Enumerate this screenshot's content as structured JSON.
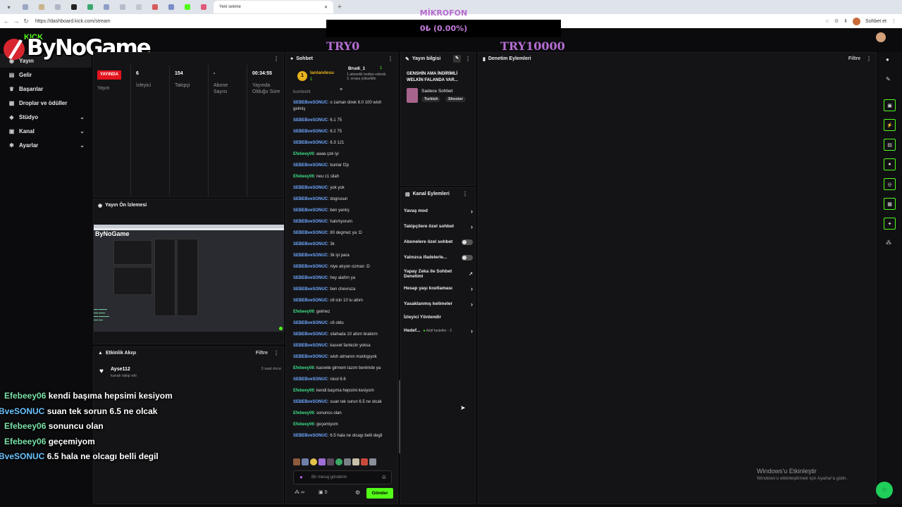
{
  "browser": {
    "active_tab": "Yeni sekme",
    "url": "https://dashboard.kick.com/stream",
    "profile_button": "Sohbet et"
  },
  "overlay": {
    "mic_label": "MİKROFON",
    "gauge_text": "0₺ (0.00%)",
    "try_min": "TRY0",
    "try_max": "TRY10000",
    "logo_text": "ByNoGame",
    "logo_kick": "KICK"
  },
  "sidebar": {
    "items": [
      {
        "label": "Yayın",
        "icon": "stream-icon"
      },
      {
        "label": "Gelir",
        "icon": "revenue-icon"
      },
      {
        "label": "Başarılar",
        "icon": "trophy-icon"
      },
      {
        "label": "Droplar ve ödüller",
        "icon": "gift-icon"
      },
      {
        "label": "Stüdyo",
        "icon": "studio-icon"
      },
      {
        "label": "Kanal",
        "icon": "channel-icon"
      },
      {
        "label": "Ayarlar",
        "icon": "settings-icon"
      }
    ]
  },
  "stats": {
    "live_badge": "YAYINDA",
    "live_label": "Yayın",
    "viewers_value": "6",
    "viewers_label": "İzleyici",
    "followers_value": "154",
    "followers_label": "Takipçi",
    "subs_value": "-",
    "subs_label": "Abone Sayısı",
    "duration_value": "00:34:55",
    "duration_label": "Yayında Olduğu Süre"
  },
  "preview": {
    "title": "Yayın Ön İzlemesi"
  },
  "activity": {
    "title": "Etkinlik Akışı",
    "filter": "Filtre",
    "event_user": "Ayse112",
    "event_text": "kanalı takip etti",
    "event_time": "3 saat önce"
  },
  "chat": {
    "title": "Sohbet",
    "pinned_user": "lanlandesu",
    "pinned_count": "1",
    "pinned_level": "1",
    "gift_user": "Brudi_1",
    "gift_text": "1 abonelik hediye ederek 3. sıraya yükseldin",
    "partial_top": "bomboktt",
    "messages": [
      {
        "user": "SEBEBveSONUC",
        "text": "o zaman direk 6.0 100 wish gelmiş",
        "c": 1
      },
      {
        "user": "SEBEBveSONUC",
        "text": "6.1 75",
        "c": 1
      },
      {
        "user": "SEBEBveSONUC",
        "text": "6.2 75",
        "c": 1
      },
      {
        "user": "SEBEBveSONUC",
        "text": "6.3 121",
        "c": 1
      },
      {
        "user": "Efebeey06",
        "text": "aaaa çok iyi",
        "c": 2
      },
      {
        "user": "SEBEBveSONUC",
        "text": "bunlar f2p",
        "c": 1
      },
      {
        "user": "Efebeey06",
        "text": "neu c1 silah",
        "c": 2
      },
      {
        "user": "SEBEBveSONUC",
        "text": "yok yok",
        "c": 1
      },
      {
        "user": "SEBEBveSONUC",
        "text": "dogrusun",
        "c": 1
      },
      {
        "user": "SEBEBveSONUC",
        "text": "ben yanlış",
        "c": 1
      },
      {
        "user": "SEBEBveSONUC",
        "text": "hatırlıyorum",
        "c": 1
      },
      {
        "user": "SEBEBveSONUC",
        "text": "80 degmez ya :D",
        "c": 1
      },
      {
        "user": "SEBEBveSONUC",
        "text": "3k",
        "c": 1
      },
      {
        "user": "SEBEBveSONUC",
        "text": "3k iyi para",
        "c": 1
      },
      {
        "user": "SEBEBveSONUC",
        "text": "niye atıyon ozman :D",
        "c": 1
      },
      {
        "user": "SEBEBveSONUC",
        "text": "hey alafım ya",
        "c": 1
      },
      {
        "user": "SEBEBveSONUC",
        "text": "ben chevruza",
        "c": 1
      },
      {
        "user": "SEBEBveSONUC",
        "text": "c6 icin 10 lu attım",
        "c": 1
      },
      {
        "user": "Efebeey06",
        "text": "gelmez",
        "c": 2
      },
      {
        "user": "SEBEBveSONUC",
        "text": "c6 oldu",
        "c": 1
      },
      {
        "user": "SEBEBveSONUC",
        "text": "silahada 10 attım braktım",
        "c": 1
      },
      {
        "user": "SEBEBveSONUC",
        "text": "kasvet fantezin yoksa",
        "c": 1
      },
      {
        "user": "SEBEBveSONUC",
        "text": "wish atmanın mantıgıyok",
        "c": 1
      },
      {
        "user": "Efebeey06",
        "text": "kasvete girmem lazım benimde ya",
        "c": 2
      },
      {
        "user": "SEBEBveSONUC",
        "text": "nicol 6.6",
        "c": 1
      },
      {
        "user": "Efebeey06",
        "text": "kendi başıma hepsimi kesiyom",
        "c": 2
      },
      {
        "user": "SEBEBveSONUC",
        "text": "suan tek sorun 6.5 ne olcak",
        "c": 1
      },
      {
        "user": "Efebeey06",
        "text": "sonuncu olan",
        "c": 2
      },
      {
        "user": "Efebeey06",
        "text": "geçemiyom",
        "c": 2
      },
      {
        "user": "SEBEBveSONUC",
        "text": "6.5 hala ne olcagı belli degil",
        "c": 1
      }
    ],
    "input_placeholder": "Bir mesaj gönderin",
    "points": "∞",
    "gift_count": "0",
    "send_label": "Gönder"
  },
  "stream_info": {
    "title": "Yayın bilgisi",
    "stream_title": "GENSHİN AMA İNDİRİMLİ WELKİN FALANDA VAR...",
    "category": "Sadece Sohbet",
    "tags": [
      "Turkish",
      "Shooter"
    ]
  },
  "channel_actions": {
    "title": "Kanal Eylemleri",
    "rows": [
      {
        "label": "Yavaş mod",
        "type": "arrow"
      },
      {
        "label": "Takipçilere özel sohbet",
        "type": "arrow"
      },
      {
        "label": "Abonelere özel sohbet",
        "type": "toggle"
      },
      {
        "label": "Yalnızca ifadelerle...",
        "type": "toggle"
      },
      {
        "label": "Yapay Zeka ile Sohbet Denetimi",
        "type": "link"
      },
      {
        "label": "Hesap yaşı kısıtlaması",
        "type": "arrow"
      },
      {
        "label": "Yasaklanmış kelimeler",
        "type": "arrow"
      },
      {
        "label": "İzleyici Yönlendir",
        "type": "none"
      },
      {
        "label": "Hedef...",
        "type": "arrow"
      }
    ],
    "goal_status": "Aktif hedefler - 2"
  },
  "moderation": {
    "title": "Denetim Eylemleri",
    "filter": "Filtre"
  },
  "overlay_chat": [
    {
      "user": "Efebeey06",
      "text": "kendi başıma hepsimi kesiyom",
      "c": 2
    },
    {
      "user": "BveSONUC",
      "text": "suan tek sorun 6.5 ne olcak",
      "c": 1
    },
    {
      "user": "Efebeey06",
      "text": "sonuncu olan",
      "c": 2
    },
    {
      "user": "Efebeey06",
      "text": "geçemiyom",
      "c": 2
    },
    {
      "user": "BveSONUC",
      "text": "6.5 hala ne olcagı belli degil",
      "c": 1
    }
  ],
  "windows": {
    "activate_title": "Windows'u Etkinleştir",
    "activate_sub": "Windows'u etkinleştirmek için Ayarlar'a gidin."
  },
  "colors": {
    "accent": "#53fc18",
    "live": "#e4141e"
  }
}
